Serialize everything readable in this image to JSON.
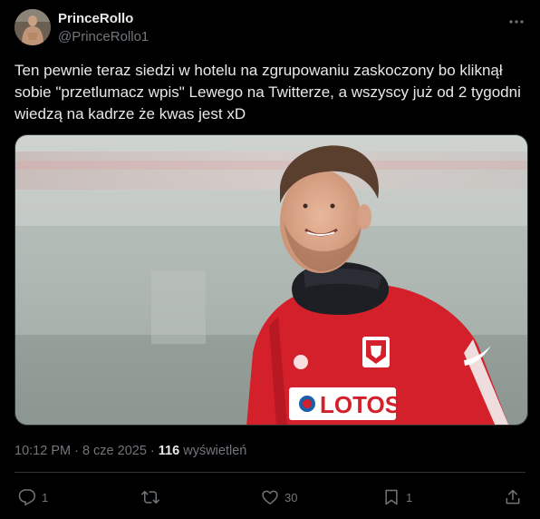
{
  "author": {
    "display_name": "PrinceRollo",
    "handle": "@PrinceRollo1"
  },
  "tweet": {
    "text": "Ten pewnie teraz siedzi w hotelu na zgrupowaniu zaskoczony bo kliknął sobie \"przetlumacz wpis\" Lewego na Twitterze, a wszyscy już od 2 tygodni wiedzą na kadrze że kwas jest xD",
    "timestamp": "10:12 PM · 8 cze 2025 · ",
    "views_count": "116",
    "views_label": "wyświetleń"
  },
  "media": {
    "shirt_text": "LOTOS"
  },
  "actions": {
    "replies": "1",
    "retweets": "",
    "likes": "30",
    "bookmarks": "1"
  },
  "colors": {
    "background": "#000000",
    "text_primary": "#e7e9ea",
    "text_secondary": "#71767b",
    "border": "#2f3336",
    "shirt_red": "#d3202a"
  }
}
